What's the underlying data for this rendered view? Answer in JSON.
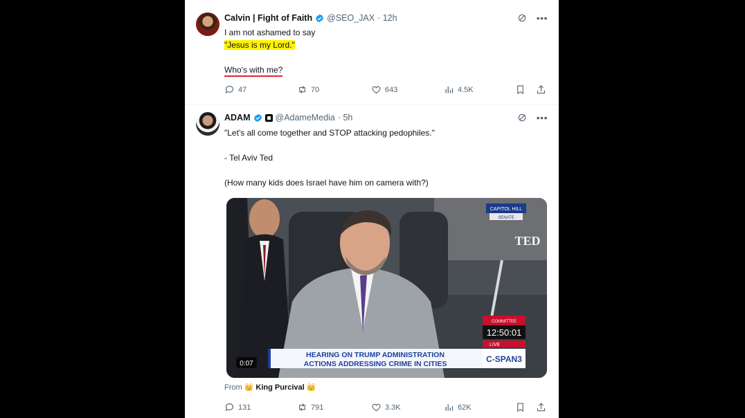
{
  "tweet1": {
    "name": "Calvin | Fight of Faith",
    "handle": "@SEO_JAX",
    "time": "· 12h",
    "line1": "I am not ashamed to say",
    "line2": "\"Jesus is my Lord.\"",
    "line3": "Who's with me?",
    "replies": "47",
    "reposts": "70",
    "likes": "643",
    "views": "4.5K"
  },
  "tweet2": {
    "name": "ADAM",
    "handle": "@AdameMedia",
    "time": "· 5h",
    "line1": "\"Let's all come together and STOP attacking pedophiles.\"",
    "line2": "- Tel Aviv Ted",
    "line3": "(How many kids does Israel have him on camera with?)",
    "video": {
      "duration": "0:07",
      "network_tag": "CAPITOL HILL",
      "network_sub": "SENATE",
      "nameplate": "TED",
      "chyron_line1": "HEARING ON TRUMP ADMINISTRATION",
      "chyron_line2": "ACTIONS ADDRESSING CRIME IN CITIES",
      "clock": "12:50:01",
      "live_label": "LIVE",
      "top_label": "COMMITTEE",
      "logo": "C-SPAN3"
    },
    "from_label": "From",
    "from_emoji1": "👑",
    "from_name": "King Purcival",
    "from_emoji2": "👑",
    "replies": "131",
    "reposts": "791",
    "likes": "3.3K",
    "views": "62K"
  },
  "colors": {
    "highlight": "#fff200",
    "underline": "#e0242e",
    "verified": "#1d9bf0",
    "muted": "#536471"
  }
}
